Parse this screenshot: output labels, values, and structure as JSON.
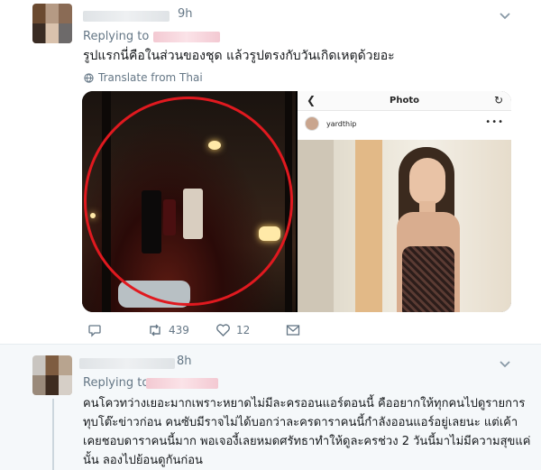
{
  "tweet1": {
    "time": "9h",
    "replying_label": "Replying to",
    "text": "รูปแรกนี่คือในส่วนของชุด แล้วรูปตรงกับวันเกิดเหตุด้วยอะ",
    "translate_label": "Translate from Thai",
    "embedded_photo": {
      "screen_title": "Photo",
      "username": "yardthip"
    },
    "actions": {
      "reply_count": "",
      "retweet_count": "439",
      "like_count": "12"
    }
  },
  "tweet2": {
    "time": "8h",
    "replying_label": "Replying to",
    "text_lines": [
      "คนโควทว่างเยอะมากเพราะหยาดไม่มีละครออนแอร์ตอนนี้ คืออยากให้ทุกคนไปดูรายการ",
      "ทุบโต๊ะข่าวก่อน คนซับมีราจไม่ได้บอกว่าละครดาราคนนี้กำลังออนแอร์อยู่เลยนะ แต่เค้า",
      "เคยชอบดาราคนนี้มาก พอเจองี้เลยหมดศรัทธาทำให้ดูละครช่วง 2 วันนี้มาไม่มีความสุขแค่",
      "นั้น ลองไปย้อนดูกันก่อน"
    ]
  },
  "colors": {
    "muted": "#657786",
    "text": "#14171a",
    "divider": "#e6ecf0",
    "highlight_bg": "#f5f8fa",
    "circle_red": "#e0191f"
  },
  "icons": [
    "chevron-down-icon",
    "globe-icon",
    "reply-icon",
    "retweet-icon",
    "heart-icon",
    "envelope-icon",
    "back-arrow-icon",
    "refresh-icon",
    "more-dots-icon"
  ]
}
